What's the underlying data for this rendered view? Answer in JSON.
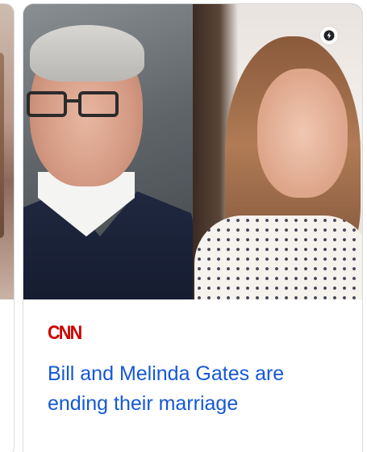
{
  "card": {
    "source": "CNN",
    "headline": "Bill and Melinda Gates are ending their marriage",
    "badge_icon": "amp-lightning-icon",
    "source_color": "#cc0000",
    "headline_color": "#1558d6"
  }
}
